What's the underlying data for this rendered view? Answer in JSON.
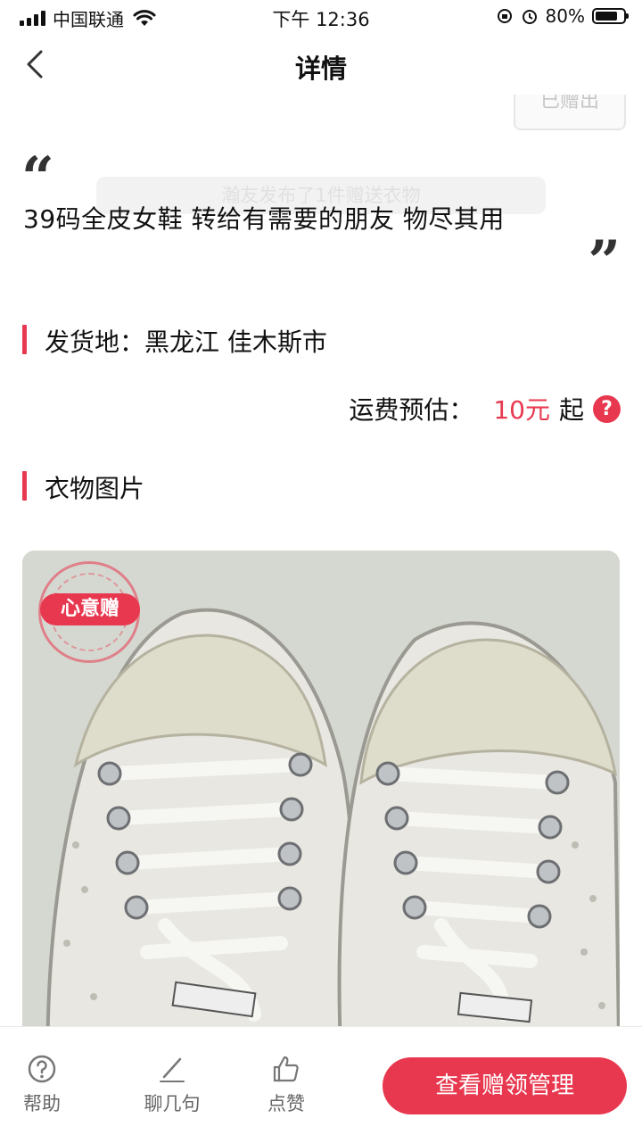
{
  "status_bar": {
    "carrier": "中国联通",
    "time": "下午 12:36",
    "battery": "80%",
    "battery_level": 0.8
  },
  "nav": {
    "title": "详情",
    "back_icon": "chevron-left-icon"
  },
  "badge": {
    "label": "已赠出"
  },
  "toast": {
    "text": "瀚友发布了1件赠送衣物"
  },
  "post": {
    "description": "39码全皮女鞋  转给有需要的朋友 物尽其用"
  },
  "shipping": {
    "origin_label": "发货地：黑龙江 佳木斯市",
    "fee_label": "运费预估：",
    "fee_value": "10元",
    "fee_suffix": "起",
    "help_icon": "?"
  },
  "photos": {
    "section_label": "衣物图片",
    "stamp_label": "心意赠"
  },
  "bottom_bar": {
    "help_label": "帮助",
    "chat_label": "聊几句",
    "like_label": "点赞",
    "primary_button": "查看赠领管理"
  },
  "colors": {
    "accent": "#e8384f",
    "text": "#111111",
    "muted": "#666666"
  }
}
